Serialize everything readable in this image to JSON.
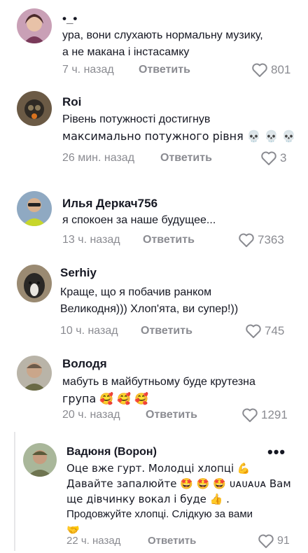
{
  "comments": [
    {
      "username": "•_•",
      "lines": [
        "ура, вони слухають нормальну музику,",
        "а не макана і інстасамку"
      ],
      "time": "7 ч. назад",
      "reply_label": "Ответить",
      "likes": "801"
    },
    {
      "username": "Roi",
      "lines": [
        "Рівень потужності достигнув",
        "максимально потужного рівня 💀 💀 💀"
      ],
      "time": "26 мин. назад",
      "reply_label": "Ответить",
      "likes": "3"
    },
    {
      "username": "Илья Деркач756",
      "lines": [
        "я спокоен за наше будущее..."
      ],
      "time": "13 ч. назад",
      "reply_label": "Ответить",
      "likes": "7363"
    },
    {
      "username": "Serhiy",
      "lines": [
        "Краще, що я побачив ранком",
        "Великодня))) Хлоп'ята, ви супер!))"
      ],
      "time": "10 ч. назад",
      "reply_label": "Ответить",
      "likes": "745"
    },
    {
      "username": "Володя",
      "lines": [
        "мабуть в майбутньому буде крутезна",
        "група 🥰 🥰 🥰"
      ],
      "time": "20 ч. назад",
      "reply_label": "Ответить",
      "likes": "1291"
    },
    {
      "username": "Вадюня (Ворон)",
      "lines": [
        "Оце вже гурт. Молодці хлопці 💪",
        "Давайте запалюйте 🤩 🤩 🤩 ᴜᴀᴜᴀᴜᴀ Вам",
        "ще дівчинку вокал і буде 👍 .",
        "Продовжуйте хлопці. Слідкую за вами",
        "🤝"
      ],
      "time": "22 ч. назад",
      "reply_label": "Ответить",
      "likes": "91",
      "more_label": "•••"
    }
  ],
  "icons": {
    "like": "heart-outline-icon",
    "more": "more-options-icon"
  },
  "colors": {
    "text": "#161823",
    "secondary": "#8a8b91",
    "divider": "#e6e6e8"
  }
}
